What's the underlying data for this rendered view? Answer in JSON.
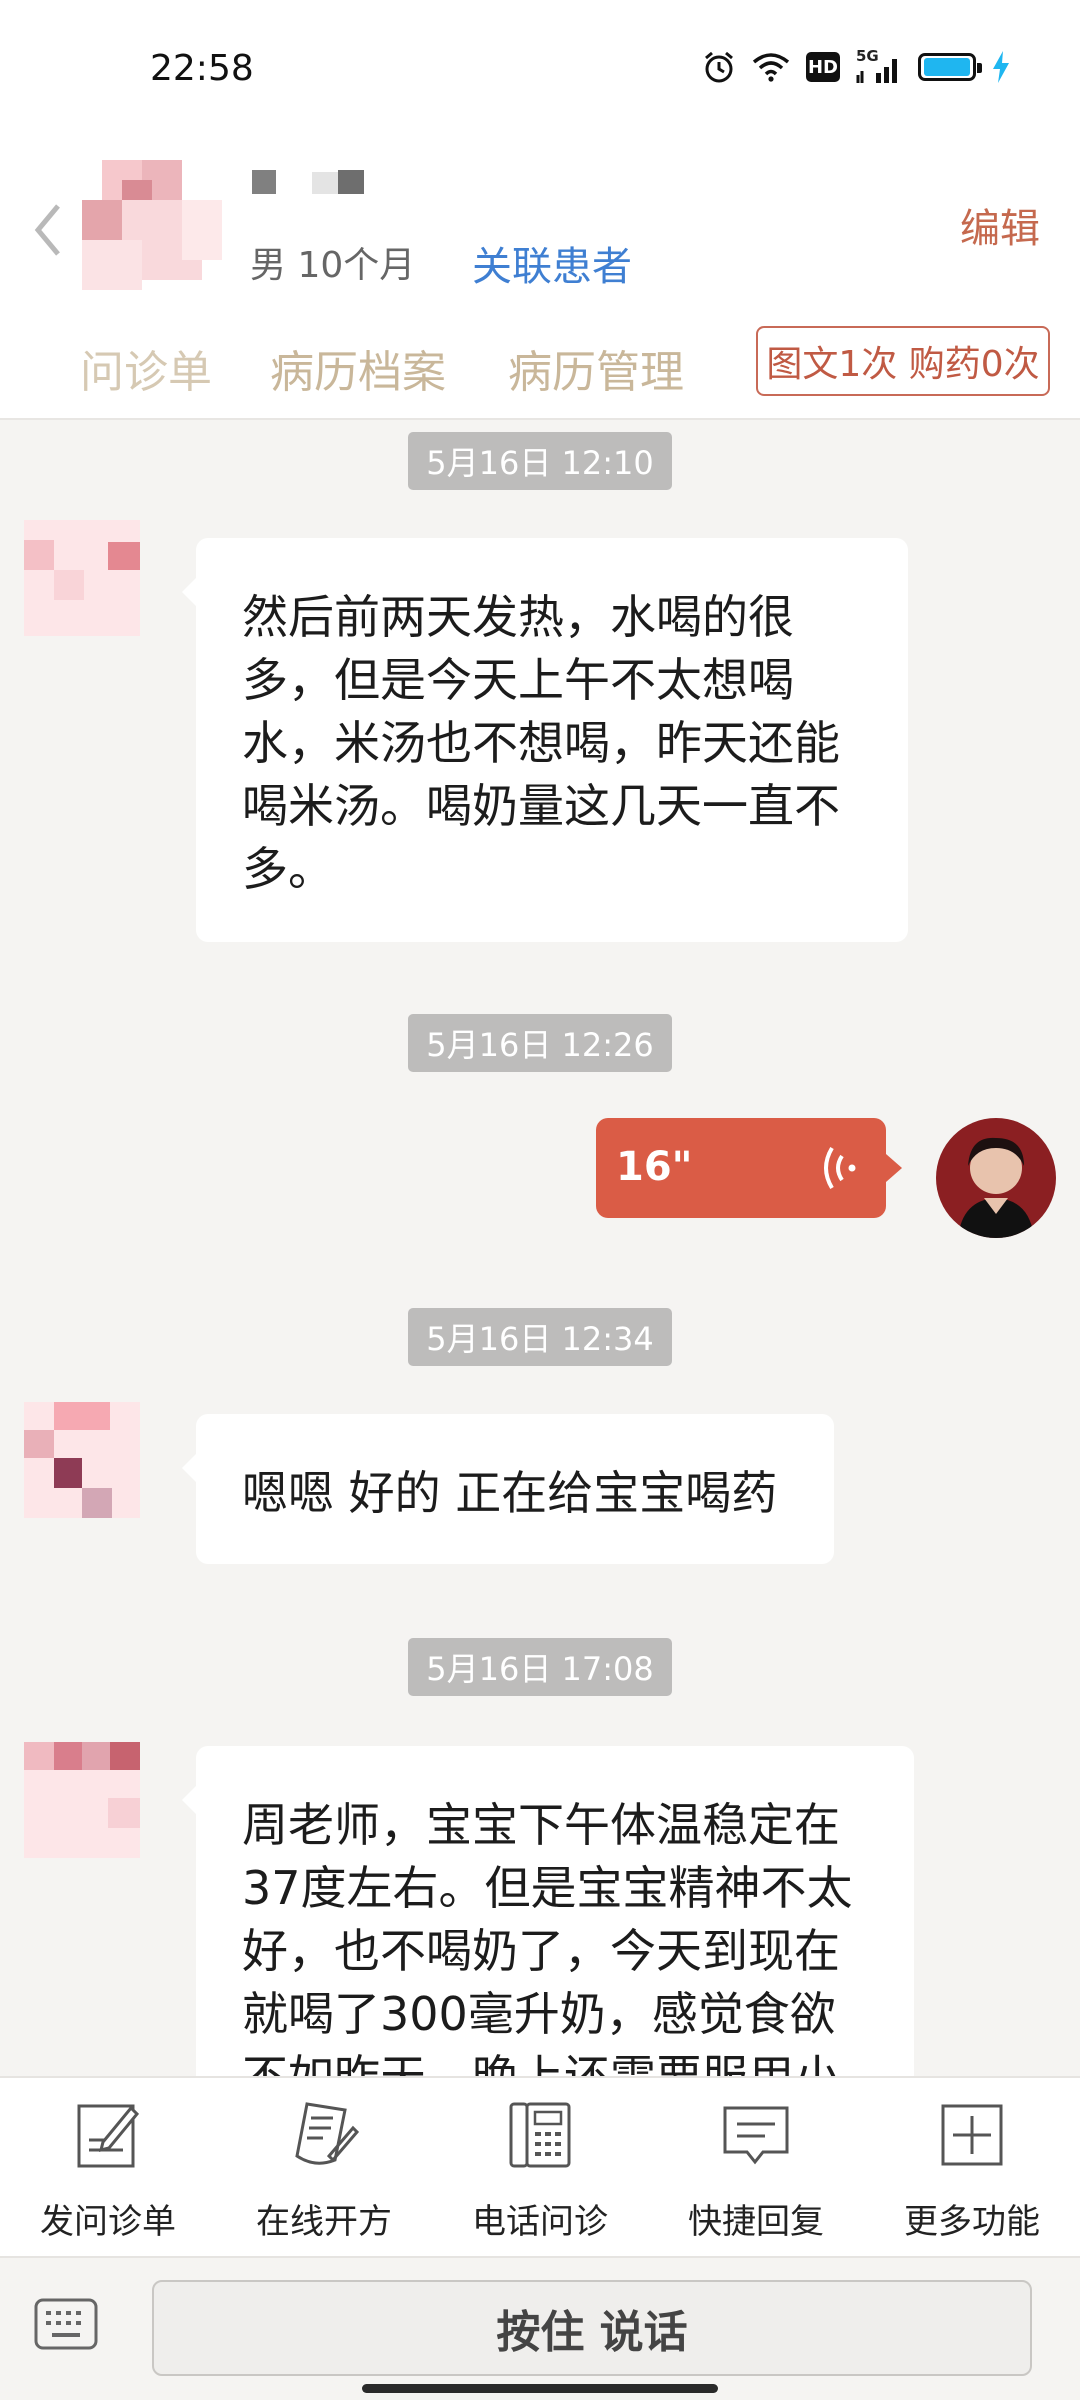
{
  "status_bar": {
    "time": "22:58",
    "hd_label": "HD",
    "network_label": "5G",
    "battery_level": 0.95,
    "icons": [
      "alarm-icon",
      "wifi-icon",
      "hd-icon",
      "signal-icon",
      "battery-icon",
      "charging-icon"
    ]
  },
  "header": {
    "patient_meta": "男 10个月",
    "link_label": "关联患者",
    "edit_label": "编辑",
    "tabs": [
      {
        "label": "问诊单"
      },
      {
        "label": "病历档案"
      },
      {
        "label": "病历管理"
      }
    ],
    "quota_badge": "图文1次 购药0次"
  },
  "messages": [
    {
      "kind": "time",
      "text": "5月16日 12:10"
    },
    {
      "kind": "text",
      "side": "left",
      "lines": [
        "然后前两天发热，水喝的很",
        "多，但是今天上午不太想喝",
        "水，米汤也不想喝，昨天还能",
        "喝米汤。喝奶量这几天一直不",
        "多。"
      ]
    },
    {
      "kind": "time",
      "text": "5月16日 12:26"
    },
    {
      "kind": "voice",
      "side": "right",
      "duration": "16\""
    },
    {
      "kind": "time",
      "text": "5月16日 12:34"
    },
    {
      "kind": "text",
      "side": "left",
      "lines": [
        "嗯嗯 好的 正在给宝宝喝药"
      ]
    },
    {
      "kind": "time",
      "text": "5月16日 17:08"
    },
    {
      "kind": "text",
      "side": "left",
      "lines": [
        "周老师，宝宝下午体温稳定在",
        "37度左右。但是宝宝精神不太",
        "好，也不喝奶了，今天到现在",
        "就喝了300毫升奶，感觉食欲",
        "不如昨天，晚上还需要服用小"
      ]
    }
  ],
  "toolbar": {
    "items": [
      {
        "label": "发问诊单",
        "icon": "form-edit-icon"
      },
      {
        "label": "在线开方",
        "icon": "prescription-icon"
      },
      {
        "label": "电话问诊",
        "icon": "phone-icon"
      },
      {
        "label": "快捷回复",
        "icon": "chat-bubble-icon"
      },
      {
        "label": "更多功能",
        "icon": "plus-square-icon"
      }
    ]
  },
  "input_bar": {
    "talk_label": "按住 说话"
  },
  "colors": {
    "accent": "#da5c46",
    "link": "#3f7fd2",
    "tab": "#c9b79a",
    "time_chip": "#bdbcbb"
  }
}
